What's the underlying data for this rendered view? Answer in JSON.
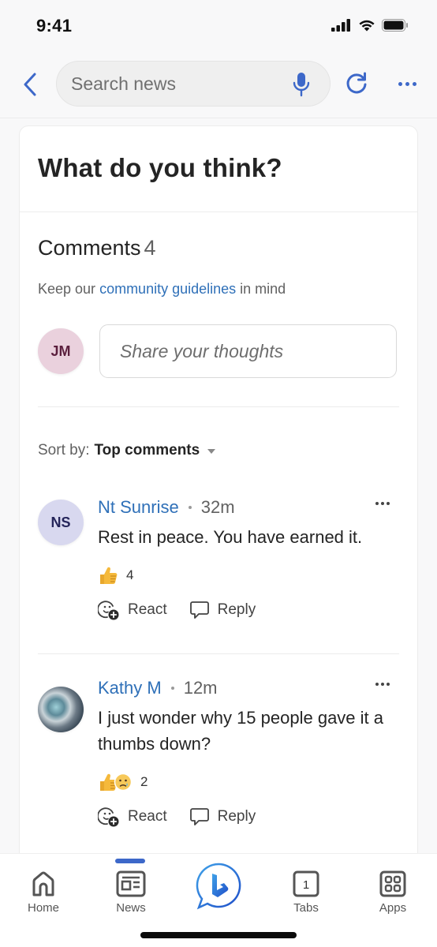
{
  "status_bar": {
    "time": "9:41"
  },
  "nav": {
    "back_icon": "chevron-left-icon",
    "search_placeholder": "Search news",
    "search_value": "",
    "mic_icon": "microphone-icon",
    "refresh_icon": "refresh-icon",
    "more_icon": "more-horizontal-icon"
  },
  "card": {
    "title": "What do you think?"
  },
  "comments": {
    "heading": "Comments",
    "count": "4",
    "guidelines_prefix": "Keep our ",
    "guidelines_link": "community guidelines",
    "guidelines_suffix": " in mind",
    "compose": {
      "avatar_initials": "JM",
      "placeholder": "Share your thoughts",
      "value": ""
    },
    "sort": {
      "label": "Sort by:",
      "value": "Top comments"
    },
    "items": [
      {
        "avatar_initials": "NS",
        "author": "Nt Sunrise",
        "age": "32m",
        "text": "Rest in peace.  You have earned it.",
        "reactions": [
          "thumbs-up"
        ],
        "reaction_count": "4",
        "react_label": "React",
        "reply_label": "Reply"
      },
      {
        "avatar_initials": "",
        "avatar_type": "photo",
        "author": "Kathy M",
        "age": "12m",
        "text": "I just wonder why 15 people gave it a thumbs down?",
        "reactions": [
          "thumbs-up",
          "crying-face"
        ],
        "reaction_count": "2",
        "react_label": "React",
        "reply_label": "Reply"
      }
    ]
  },
  "tab_bar": {
    "active": "News",
    "tabs": [
      {
        "label": "Home",
        "icon": "home-icon"
      },
      {
        "label": "News",
        "icon": "news-icon"
      },
      {
        "label": "",
        "icon": "copilot-icon"
      },
      {
        "label": "Tabs",
        "icon": "tabs-icon",
        "badge": "1"
      },
      {
        "label": "Apps",
        "icon": "apps-icon"
      }
    ]
  },
  "colors": {
    "accent": "#3d68c9",
    "link": "#2f70b8",
    "text": "#242424",
    "muted": "#616161"
  }
}
